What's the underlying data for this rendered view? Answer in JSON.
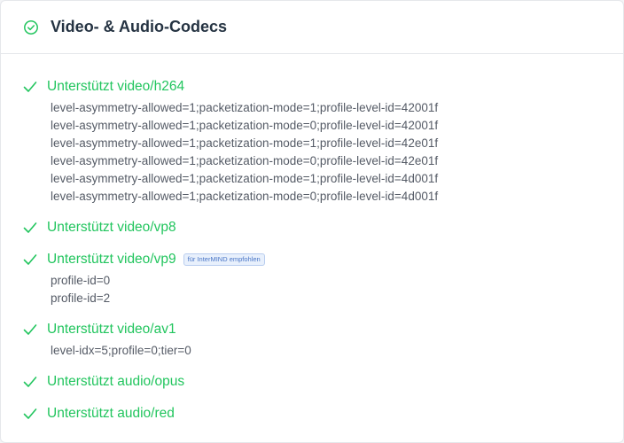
{
  "header": {
    "title": "Video- & Audio-Codecs",
    "icon": "check-circle-icon"
  },
  "colors": {
    "accent": "#22c55e",
    "title": "#253342",
    "param": "#555b66",
    "badge": "#4a76c7"
  },
  "codecs": [
    {
      "label": "Unterstützt video/h264",
      "badge": null,
      "params": [
        "level-asymmetry-allowed=1;packetization-mode=1;profile-level-id=42001f",
        "level-asymmetry-allowed=1;packetization-mode=0;profile-level-id=42001f",
        "level-asymmetry-allowed=1;packetization-mode=1;profile-level-id=42e01f",
        "level-asymmetry-allowed=1;packetization-mode=0;profile-level-id=42e01f",
        "level-asymmetry-allowed=1;packetization-mode=1;profile-level-id=4d001f",
        "level-asymmetry-allowed=1;packetization-mode=0;profile-level-id=4d001f"
      ]
    },
    {
      "label": "Unterstützt video/vp8",
      "badge": null,
      "params": []
    },
    {
      "label": "Unterstützt video/vp9",
      "badge": "für InterMIND empfohlen",
      "params": [
        "profile-id=0",
        "profile-id=2"
      ]
    },
    {
      "label": "Unterstützt video/av1",
      "badge": null,
      "params": [
        "level-idx=5;profile=0;tier=0"
      ]
    },
    {
      "label": "Unterstützt audio/opus",
      "badge": null,
      "params": []
    },
    {
      "label": "Unterstützt audio/red",
      "badge": null,
      "params": []
    }
  ]
}
